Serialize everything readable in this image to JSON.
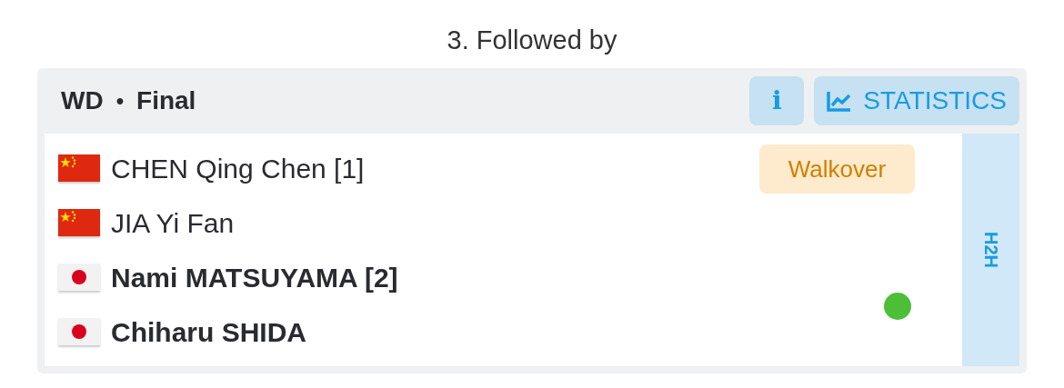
{
  "heading": "3. Followed by",
  "match": {
    "event": "WD",
    "separator": "•",
    "round": "Final",
    "info_button": "i",
    "stats_button": "STATISTICS",
    "h2h": "H2H",
    "teams": [
      {
        "winner": false,
        "status": "Walkover",
        "players": [
          {
            "kind": "cn",
            "name": "CHEN Qing Chen [1]"
          },
          {
            "kind": "cn",
            "name": "JIA Yi Fan"
          }
        ]
      },
      {
        "winner": true,
        "players": [
          {
            "kind": "jp",
            "name": "Nami MATSUYAMA [2]"
          },
          {
            "kind": "jp",
            "name": "Chiharu SHIDA"
          }
        ]
      }
    ]
  }
}
